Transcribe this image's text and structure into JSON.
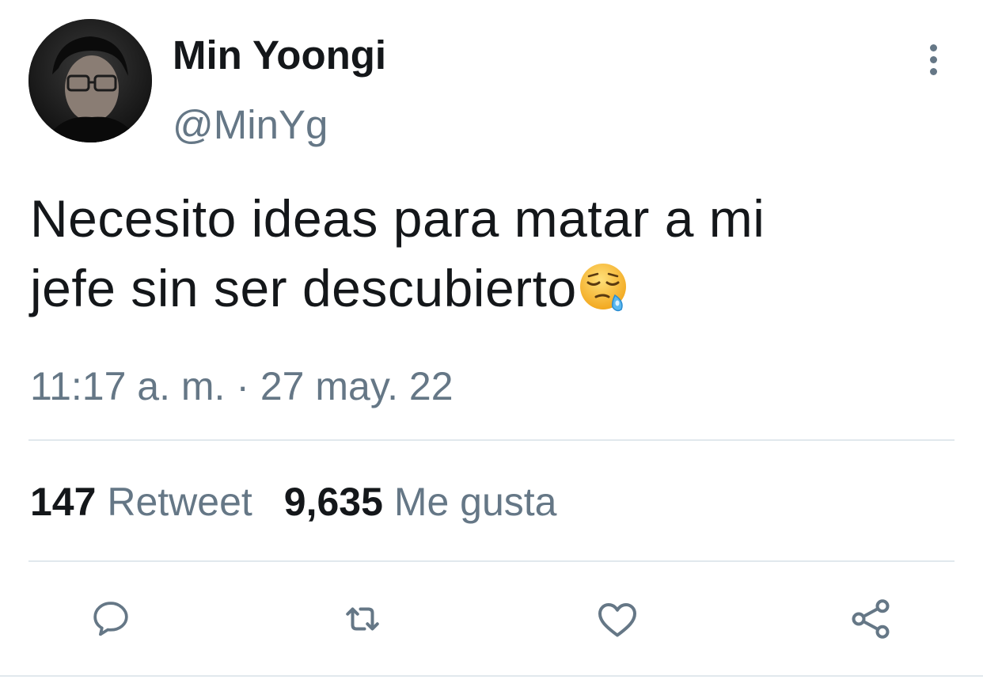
{
  "tweet": {
    "author": {
      "display_name": "Min Yoongi",
      "handle": "@MinYg",
      "avatar": "profile-photo"
    },
    "text_lines": [
      "Necesito ideas para matar a mi",
      "jefe sin ser descubierto"
    ],
    "emoji": "sleepy-face-emoji",
    "timestamp": "11:17 a. m. · 27 may. 22",
    "stats": {
      "retweets_count": "147",
      "retweets_label": "Retweet",
      "likes_count": "9,635",
      "likes_label": "Me gusta"
    }
  },
  "actions": [
    {
      "icon": "reply-icon"
    },
    {
      "icon": "retweet-icon"
    },
    {
      "icon": "like-icon"
    },
    {
      "icon": "share-icon"
    }
  ],
  "colors": {
    "text_primary": "#14171a",
    "text_secondary": "#657786",
    "divider": "#e1e8ed",
    "background": "#ffffff"
  }
}
